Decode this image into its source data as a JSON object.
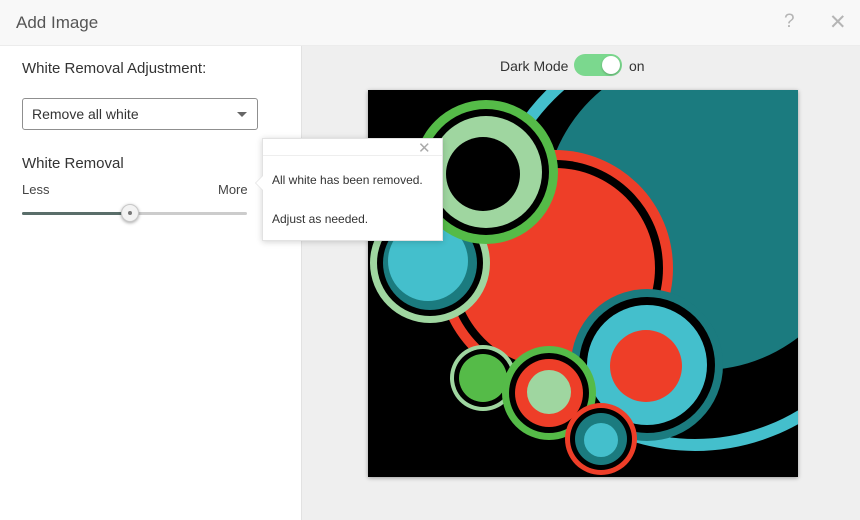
{
  "header": {
    "title": "Add Image",
    "help_icon": "?",
    "close_icon": "✕"
  },
  "left_panel": {
    "adjustment_label": "White Removal Adjustment:",
    "dropdown": {
      "selected": "Remove all white"
    },
    "slider_label": "White Removal",
    "slider_min_label": "Less",
    "slider_max_label": "More",
    "slider_value_fraction": 0.48
  },
  "right_panel": {
    "dark_mode_label": "Dark Mode",
    "dark_mode_state": "on",
    "toggle_color": "#7bd88e",
    "image_background": "#000000"
  },
  "popover": {
    "close_icon": "✕",
    "line1": "All white has been removed.",
    "line2": "Adjust as needed."
  },
  "colors": {
    "teal": "#1b7b7f",
    "cyan": "#44bfcc",
    "red": "#ee3e28",
    "green": "#55bb48",
    "mint": "#9fd6a0"
  }
}
